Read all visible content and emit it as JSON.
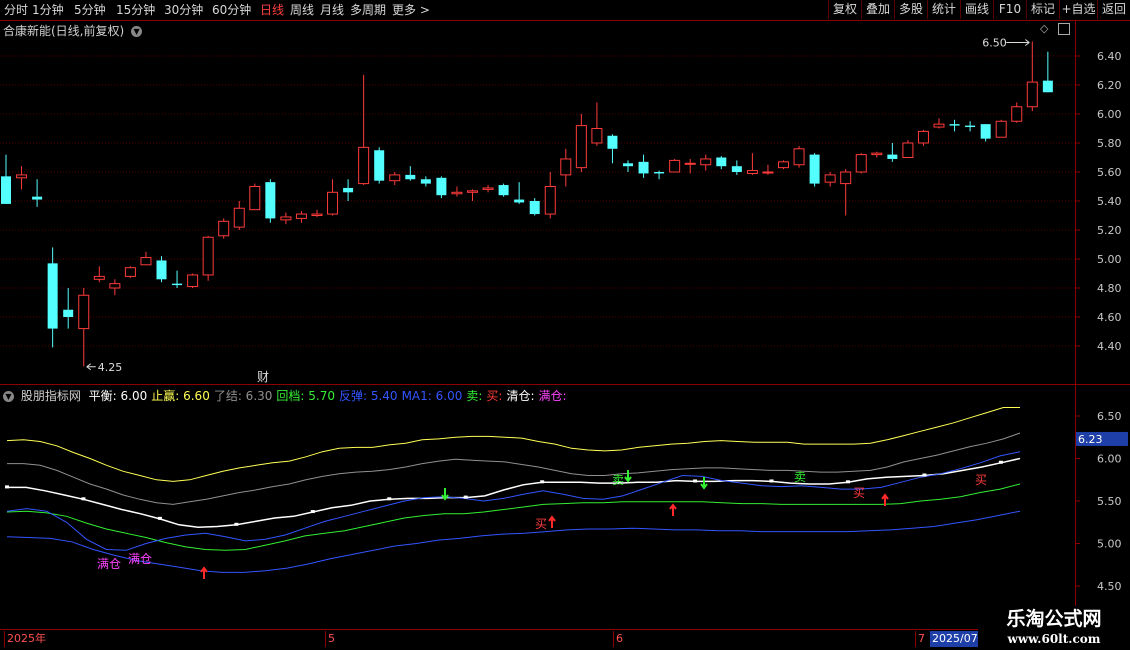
{
  "toolbar": {
    "periods": [
      "分时",
      "1分钟",
      "5分钟",
      "15分钟",
      "30分钟",
      "60分钟",
      "日线",
      "周线",
      "月线",
      "多周期",
      "更多 >"
    ],
    "active_period": "日线",
    "right_buttons": [
      "复权",
      "叠加",
      "多股",
      "统计",
      "画线",
      "F10",
      "标记",
      "+自选",
      "返回"
    ]
  },
  "main_chart": {
    "title": "合康新能(日线,前复权)",
    "y_ticks": [
      "6.40",
      "6.20",
      "6.00",
      "5.80",
      "5.60",
      "5.40",
      "5.20",
      "5.00",
      "4.80",
      "4.60",
      "4.40"
    ],
    "high_marker": "6.50",
    "low_marker": "4.25",
    "finance_marker": "财",
    "colors": {
      "up": "#ff3b3b",
      "down": "#54ffff",
      "grid": "#5a0000"
    }
  },
  "indicator": {
    "name": "股朋指标网",
    "items": [
      {
        "text": "平衡: 6.00",
        "color": "#ffffff"
      },
      {
        "text": "止赢: 6.60",
        "color": "#ffff55"
      },
      {
        "text": "了结: 6.30",
        "color": "#909090"
      },
      {
        "text": "回档: 5.70",
        "color": "#33ee33"
      },
      {
        "text": "反弹: 5.40",
        "color": "#3355ff"
      },
      {
        "text": "MA1: 6.00",
        "color": "#3355ff"
      },
      {
        "text": "卖:",
        "color": "#33ee33"
      },
      {
        "text": "买:",
        "color": "#ff3b3b"
      },
      {
        "text": "清仓:",
        "color": "#ffffff"
      },
      {
        "text": "满仓:",
        "color": "#ff44ff"
      }
    ],
    "y_ticks": [
      "6.50",
      "6.00",
      "5.50",
      "5.00",
      "4.50"
    ],
    "current_value": "6.23",
    "signal_labels": {
      "sell": "卖",
      "buy": "买",
      "full": "满仓"
    }
  },
  "date_axis": {
    "labels": [
      "2025年",
      "5",
      "6",
      "7"
    ],
    "current_date": "2025/07"
  },
  "watermark": {
    "line1": "乐淘公式网",
    "line2": "www.60lt.com"
  },
  "chart_data": {
    "type": "candlestick",
    "title": "合康新能(日线,前复权)",
    "ylim": [
      4.25,
      6.56
    ],
    "candles": [
      {
        "o": 5.57,
        "c": 5.38,
        "h": 5.72,
        "l": 5.38
      },
      {
        "o": 5.56,
        "c": 5.58,
        "h": 5.64,
        "l": 5.48
      },
      {
        "o": 5.43,
        "c": 5.41,
        "h": 5.55,
        "l": 5.36
      },
      {
        "o": 4.97,
        "c": 4.52,
        "h": 5.08,
        "l": 4.39
      },
      {
        "o": 4.65,
        "c": 4.6,
        "h": 4.8,
        "l": 4.52
      },
      {
        "o": 4.52,
        "c": 4.75,
        "h": 4.8,
        "l": 4.26
      },
      {
        "o": 4.86,
        "c": 4.88,
        "h": 4.95,
        "l": 4.84
      },
      {
        "o": 4.8,
        "c": 4.83,
        "h": 4.86,
        "l": 4.75
      },
      {
        "o": 4.88,
        "c": 4.94,
        "h": 4.95,
        "l": 4.87
      },
      {
        "o": 4.96,
        "c": 5.01,
        "h": 5.05,
        "l": 4.96
      },
      {
        "o": 4.99,
        "c": 4.86,
        "h": 5.02,
        "l": 4.84
      },
      {
        "o": 4.83,
        "c": 4.82,
        "h": 4.92,
        "l": 4.8
      },
      {
        "o": 4.81,
        "c": 4.89,
        "h": 4.9,
        "l": 4.8
      },
      {
        "o": 4.89,
        "c": 5.15,
        "h": 5.16,
        "l": 4.85
      },
      {
        "o": 5.16,
        "c": 5.26,
        "h": 5.28,
        "l": 5.14
      },
      {
        "o": 5.22,
        "c": 5.35,
        "h": 5.4,
        "l": 5.2
      },
      {
        "o": 5.34,
        "c": 5.5,
        "h": 5.52,
        "l": 5.34
      },
      {
        "o": 5.53,
        "c": 5.28,
        "h": 5.55,
        "l": 5.25
      },
      {
        "o": 5.27,
        "c": 5.29,
        "h": 5.32,
        "l": 5.24
      },
      {
        "o": 5.28,
        "c": 5.31,
        "h": 5.33,
        "l": 5.25
      },
      {
        "o": 5.3,
        "c": 5.31,
        "h": 5.34,
        "l": 5.29
      },
      {
        "o": 5.31,
        "c": 5.46,
        "h": 5.55,
        "l": 5.3
      },
      {
        "o": 5.49,
        "c": 5.46,
        "h": 5.55,
        "l": 5.4
      },
      {
        "o": 5.52,
        "c": 5.77,
        "h": 6.27,
        "l": 5.51
      },
      {
        "o": 5.75,
        "c": 5.54,
        "h": 5.77,
        "l": 5.52
      },
      {
        "o": 5.54,
        "c": 5.58,
        "h": 5.6,
        "l": 5.51
      },
      {
        "o": 5.58,
        "c": 5.55,
        "h": 5.64,
        "l": 5.54
      },
      {
        "o": 5.55,
        "c": 5.52,
        "h": 5.57,
        "l": 5.5
      },
      {
        "o": 5.56,
        "c": 5.44,
        "h": 5.57,
        "l": 5.42
      },
      {
        "o": 5.45,
        "c": 5.46,
        "h": 5.5,
        "l": 5.43
      },
      {
        "o": 5.46,
        "c": 5.47,
        "h": 5.48,
        "l": 5.4
      },
      {
        "o": 5.48,
        "c": 5.49,
        "h": 5.51,
        "l": 5.46
      },
      {
        "o": 5.51,
        "c": 5.44,
        "h": 5.52,
        "l": 5.43
      },
      {
        "o": 5.41,
        "c": 5.39,
        "h": 5.53,
        "l": 5.38
      },
      {
        "o": 5.4,
        "c": 5.31,
        "h": 5.42,
        "l": 5.3
      },
      {
        "o": 5.31,
        "c": 5.5,
        "h": 5.6,
        "l": 5.28
      },
      {
        "o": 5.58,
        "c": 5.69,
        "h": 5.76,
        "l": 5.5
      },
      {
        "o": 5.63,
        "c": 5.92,
        "h": 6.0,
        "l": 5.6
      },
      {
        "o": 5.8,
        "c": 5.9,
        "h": 6.08,
        "l": 5.78
      },
      {
        "o": 5.85,
        "c": 5.76,
        "h": 5.86,
        "l": 5.66
      },
      {
        "o": 5.66,
        "c": 5.64,
        "h": 5.68,
        "l": 5.6
      },
      {
        "o": 5.67,
        "c": 5.59,
        "h": 5.72,
        "l": 5.56
      },
      {
        "o": 5.6,
        "c": 5.59,
        "h": 5.61,
        "l": 5.55
      },
      {
        "o": 5.6,
        "c": 5.68,
        "h": 5.69,
        "l": 5.6
      },
      {
        "o": 5.66,
        "c": 5.66,
        "h": 5.69,
        "l": 5.59
      },
      {
        "o": 5.65,
        "c": 5.69,
        "h": 5.72,
        "l": 5.61
      },
      {
        "o": 5.7,
        "c": 5.64,
        "h": 5.71,
        "l": 5.62
      },
      {
        "o": 5.64,
        "c": 5.6,
        "h": 5.68,
        "l": 5.58
      },
      {
        "o": 5.59,
        "c": 5.61,
        "h": 5.73,
        "l": 5.58
      },
      {
        "o": 5.6,
        "c": 5.6,
        "h": 5.65,
        "l": 5.58
      },
      {
        "o": 5.63,
        "c": 5.67,
        "h": 5.68,
        "l": 5.62
      },
      {
        "o": 5.65,
        "c": 5.76,
        "h": 5.78,
        "l": 5.63
      },
      {
        "o": 5.72,
        "c": 5.52,
        "h": 5.73,
        "l": 5.5
      },
      {
        "o": 5.53,
        "c": 5.58,
        "h": 5.6,
        "l": 5.5
      },
      {
        "o": 5.52,
        "c": 5.6,
        "h": 5.62,
        "l": 5.3
      },
      {
        "o": 5.6,
        "c": 5.72,
        "h": 5.73,
        "l": 5.59
      },
      {
        "o": 5.72,
        "c": 5.73,
        "h": 5.74,
        "l": 5.7
      },
      {
        "o": 5.72,
        "c": 5.69,
        "h": 5.8,
        "l": 5.67
      },
      {
        "o": 5.7,
        "c": 5.8,
        "h": 5.82,
        "l": 5.7
      },
      {
        "o": 5.8,
        "c": 5.88,
        "h": 5.89,
        "l": 5.78
      },
      {
        "o": 5.91,
        "c": 5.93,
        "h": 5.97,
        "l": 5.9
      },
      {
        "o": 5.93,
        "c": 5.92,
        "h": 5.96,
        "l": 5.88
      },
      {
        "o": 5.92,
        "c": 5.91,
        "h": 5.95,
        "l": 5.88
      },
      {
        "o": 5.93,
        "c": 5.83,
        "h": 5.93,
        "l": 5.81
      },
      {
        "o": 5.84,
        "c": 5.95,
        "h": 5.96,
        "l": 5.84
      },
      {
        "o": 5.95,
        "c": 6.05,
        "h": 6.08,
        "l": 5.94
      },
      {
        "o": 6.05,
        "c": 6.22,
        "h": 6.5,
        "l": 6.02
      },
      {
        "o": 6.23,
        "c": 6.15,
        "h": 6.43,
        "l": 6.15
      }
    ],
    "indicator_ylim": [
      4.35,
      6.78
    ],
    "indicator_series": [
      {
        "name": "止赢",
        "color": "#ffff55",
        "values": [
          6.21,
          6.22,
          6.2,
          6.15,
          6.07,
          6.0,
          5.92,
          5.85,
          5.8,
          5.75,
          5.73,
          5.75,
          5.8,
          5.85,
          5.89,
          5.92,
          5.95,
          5.97,
          6.02,
          6.08,
          6.12,
          6.13,
          6.13,
          6.16,
          6.18,
          6.22,
          6.23,
          6.25,
          6.26,
          6.26,
          6.25,
          6.24,
          6.2,
          6.17,
          6.12,
          6.1,
          6.09,
          6.1,
          6.13,
          6.15,
          6.17,
          6.18,
          6.2,
          6.21,
          6.2,
          6.19,
          6.19,
          6.19,
          6.17,
          6.17,
          6.17,
          6.17,
          6.18,
          6.22,
          6.27,
          6.32,
          6.37,
          6.42,
          6.48,
          6.54,
          6.6,
          6.6
        ]
      },
      {
        "name": "了结",
        "color": "#909090",
        "values": [
          5.94,
          5.94,
          5.92,
          5.86,
          5.78,
          5.7,
          5.64,
          5.57,
          5.52,
          5.48,
          5.46,
          5.49,
          5.52,
          5.56,
          5.6,
          5.63,
          5.67,
          5.7,
          5.75,
          5.79,
          5.82,
          5.84,
          5.85,
          5.87,
          5.9,
          5.94,
          5.97,
          5.99,
          5.98,
          5.97,
          5.96,
          5.93,
          5.9,
          5.86,
          5.82,
          5.8,
          5.8,
          5.82,
          5.83,
          5.85,
          5.87,
          5.88,
          5.89,
          5.89,
          5.88,
          5.87,
          5.86,
          5.86,
          5.85,
          5.84,
          5.84,
          5.85,
          5.86,
          5.9,
          5.96,
          6.0,
          6.04,
          6.09,
          6.14,
          6.18,
          6.23,
          6.3
        ]
      },
      {
        "name": "平衡",
        "color": "#ffffff",
        "values": [
          5.66,
          5.66,
          5.62,
          5.57,
          5.52,
          5.46,
          5.4,
          5.35,
          5.29,
          5.22,
          5.19,
          5.2,
          5.22,
          5.26,
          5.3,
          5.32,
          5.37,
          5.42,
          5.45,
          5.5,
          5.52,
          5.53,
          5.53,
          5.54,
          5.54,
          5.56,
          5.63,
          5.69,
          5.72,
          5.72,
          5.72,
          5.71,
          5.71,
          5.72,
          5.72,
          5.74,
          5.73,
          5.73,
          5.74,
          5.74,
          5.73,
          5.71,
          5.7,
          5.7,
          5.72,
          5.76,
          5.78,
          5.79,
          5.8,
          5.82,
          5.86,
          5.9,
          5.95,
          6.0
        ]
      },
      {
        "name": "回档",
        "color": "#33ee33",
        "values": [
          5.37,
          5.38,
          5.36,
          5.32,
          5.24,
          5.17,
          5.12,
          5.07,
          5.01,
          4.96,
          4.93,
          4.92,
          4.93,
          4.98,
          5.03,
          5.09,
          5.12,
          5.15,
          5.2,
          5.25,
          5.3,
          5.33,
          5.35,
          5.35,
          5.37,
          5.4,
          5.43,
          5.46,
          5.47,
          5.48,
          5.48,
          5.49,
          5.49,
          5.49,
          5.49,
          5.49,
          5.48,
          5.47,
          5.47,
          5.46,
          5.46,
          5.46,
          5.46,
          5.46,
          5.46,
          5.47,
          5.5,
          5.52,
          5.55,
          5.6,
          5.64,
          5.7
        ]
      },
      {
        "name": "反弹",
        "color": "#3355ff",
        "values": [
          5.08,
          5.07,
          5.06,
          5.02,
          4.93,
          4.86,
          4.8,
          4.76,
          4.72,
          4.68,
          4.66,
          4.66,
          4.68,
          4.71,
          4.76,
          4.82,
          4.87,
          4.92,
          4.97,
          5.0,
          5.04,
          5.06,
          5.09,
          5.11,
          5.12,
          5.14,
          5.16,
          5.17,
          5.17,
          5.18,
          5.17,
          5.16,
          5.16,
          5.15,
          5.15,
          5.14,
          5.14,
          5.14,
          5.14,
          5.14,
          5.15,
          5.16,
          5.18,
          5.2,
          5.24,
          5.28,
          5.33,
          5.38
        ]
      },
      {
        "name": "MA1",
        "color": "#3355ff",
        "values": [
          5.38,
          5.41,
          5.38,
          5.25,
          5.05,
          4.93,
          4.92,
          5.0,
          5.06,
          5.1,
          5.12,
          5.08,
          5.03,
          5.05,
          5.1,
          5.18,
          5.26,
          5.32,
          5.38,
          5.44,
          5.5,
          5.54,
          5.55,
          5.53,
          5.5,
          5.53,
          5.58,
          5.62,
          5.58,
          5.53,
          5.52,
          5.56,
          5.64,
          5.72,
          5.8,
          5.79,
          5.74,
          5.71,
          5.68,
          5.67,
          5.68,
          5.66,
          5.64,
          5.64,
          5.66,
          5.72,
          5.78,
          5.82,
          5.88,
          5.95,
          6.03,
          6.08
        ]
      }
    ]
  }
}
